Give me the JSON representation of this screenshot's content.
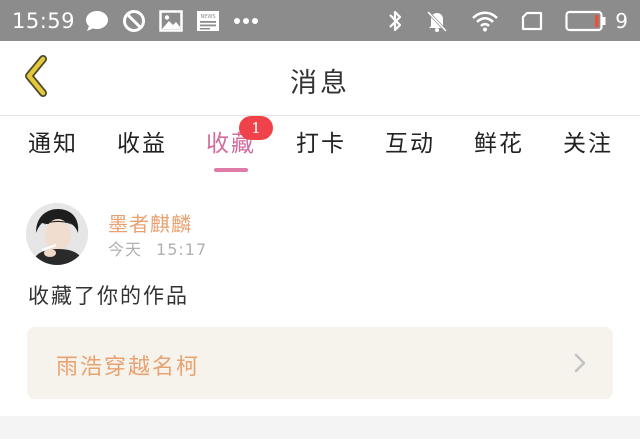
{
  "status_bar": {
    "time": "15:59",
    "left_icons": [
      "message-bubble-icon",
      "blocked-icon",
      "image-icon",
      "news-icon",
      "more-dots-icon"
    ],
    "right_icons": [
      "bluetooth-icon",
      "muted-bell-icon",
      "wifi-icon",
      "sim-icon",
      "battery-icon"
    ],
    "battery_percent": "9",
    "battery_level": 0.09,
    "battery_low_color": "#e8523a"
  },
  "header": {
    "title": "消息",
    "back_icon": "back-chevron-icon",
    "back_icon_color": "#e5c83a"
  },
  "tabs": [
    {
      "label": "通知",
      "active": false
    },
    {
      "label": "收益",
      "active": false
    },
    {
      "label": "收藏",
      "active": true,
      "badge": "1"
    },
    {
      "label": "打卡",
      "active": false
    },
    {
      "label": "互动",
      "active": false
    },
    {
      "label": "鲜花",
      "active": false
    },
    {
      "label": "关注",
      "active": false
    }
  ],
  "message": {
    "sender_name": "墨者麒麟",
    "date": "今天",
    "time": "15:17",
    "text": "收藏了你的作品",
    "work_title": "雨浩穿越名柯"
  },
  "colors": {
    "accent_pink": "#d46a9c",
    "accent_orange": "#e8a271",
    "badge_red": "#f0424a",
    "card_background": "#f6f3ec"
  }
}
